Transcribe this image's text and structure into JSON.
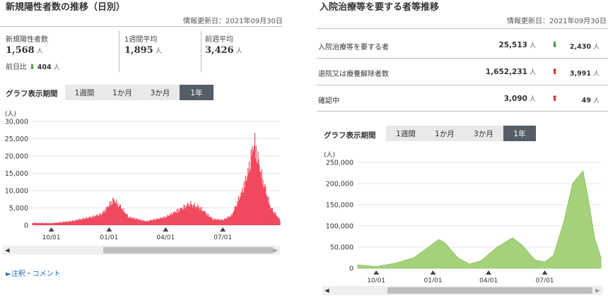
{
  "left": {
    "title": "新規陽性者数の推移（日別）",
    "updated": "情報更新日：2021年09月30日",
    "stats": [
      {
        "label": "新規陽性者数",
        "value": "1,568",
        "unit": "人"
      },
      {
        "label": "1週間平均",
        "value": "1,895",
        "unit": "人"
      },
      {
        "label": "前週平均",
        "value": "3,426",
        "unit": "人"
      }
    ],
    "prev_day": {
      "label": "前日比",
      "arrow": "⬇",
      "value": "404",
      "unit": "人"
    },
    "period_label": "グラフ表示期間",
    "period_buttons": [
      "1週間",
      "1か月",
      "3か月",
      "1年"
    ],
    "active_period": "1年",
    "note_link": "►注釈・コメント"
  },
  "right": {
    "title": "入院治療等を要する者等推移",
    "updated": "情報更新日：2021年09月30日",
    "rows": [
      {
        "label": "入院治療等を要する者",
        "value": "25,513",
        "unit": "人",
        "arrow": "⬇",
        "direction": "down",
        "diff": "2,430",
        "diff_unit": "人"
      },
      {
        "label": "退院又は療養解除者数",
        "value": "1,652,231",
        "unit": "人",
        "arrow": "⬆",
        "direction": "up",
        "diff": "3,991",
        "diff_unit": "人"
      },
      {
        "label": "確認中",
        "value": "3,090",
        "unit": "人",
        "arrow": "⬆",
        "direction": "up",
        "diff": "49",
        "diff_unit": "人"
      }
    ],
    "period_label": "グラフ表示期間",
    "period_buttons": [
      "1週間",
      "1か月",
      "3か月",
      "1年"
    ],
    "active_period": "1年"
  },
  "colors": {
    "left_series": "#f0485e",
    "right_series": "#a5d17a",
    "accent_dark": "#555e66",
    "down": "#2f9a3a",
    "up": "#d9262d"
  },
  "chart_data": [
    {
      "type": "bar",
      "unit_label": "(人)",
      "ylim": [
        0,
        30000
      ],
      "yticks": [
        "30,000",
        "25,000",
        "20,000",
        "15,000",
        "10,000",
        "5,000",
        "0"
      ],
      "xticks": [
        "10/01",
        "01/01",
        "04/01",
        "07/01"
      ],
      "grid": true,
      "x": [
        "2020-09-01",
        "2020-10-01",
        "2020-11-01",
        "2020-12-01",
        "2020-12-20",
        "2021-01-08",
        "2021-01-20",
        "2021-02-01",
        "2021-03-01",
        "2021-04-01",
        "2021-04-20",
        "2021-05-10",
        "2021-05-25",
        "2021-06-15",
        "2021-07-01",
        "2021-07-15",
        "2021-08-01",
        "2021-08-10",
        "2021-08-20",
        "2021-09-01",
        "2021-09-15",
        "2021-09-30"
      ],
      "values": [
        700,
        600,
        1200,
        2400,
        3400,
        7800,
        5500,
        2500,
        1200,
        2500,
        4500,
        6600,
        5400,
        1900,
        1600,
        3000,
        10500,
        16000,
        25600,
        15000,
        5500,
        1600
      ]
    },
    {
      "type": "area",
      "unit_label": "(人)",
      "ylim": [
        0,
        250000
      ],
      "yticks": [
        "250,000",
        "200,000",
        "150,000",
        "100,000",
        "50,000",
        "0"
      ],
      "xticks": [
        "10/01",
        "01/01",
        "04/01",
        "07/01"
      ],
      "grid": true,
      "x": [
        "2020-09-01",
        "2020-10-01",
        "2020-11-01",
        "2020-12-01",
        "2020-12-20",
        "2021-01-10",
        "2021-01-20",
        "2021-02-10",
        "2021-03-01",
        "2021-03-20",
        "2021-04-15",
        "2021-05-10",
        "2021-05-25",
        "2021-06-15",
        "2021-07-01",
        "2021-07-15",
        "2021-08-01",
        "2021-08-15",
        "2021-09-01",
        "2021-09-10",
        "2021-09-20",
        "2021-09-30"
      ],
      "values": [
        8000,
        4000,
        12000,
        25000,
        45000,
        68000,
        60000,
        25000,
        10000,
        18000,
        50000,
        72000,
        55000,
        20000,
        15000,
        30000,
        110000,
        200000,
        230000,
        160000,
        70000,
        25500
      ]
    }
  ]
}
